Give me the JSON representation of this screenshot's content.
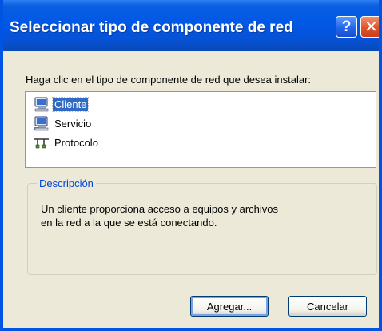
{
  "window": {
    "title": "Seleccionar tipo de componente de red",
    "help_label": "?",
    "close_label": "✕"
  },
  "prompt": "Haga clic en el tipo de componente de red que desea instalar:",
  "components": [
    {
      "label": "Cliente",
      "icon": "client-computer-icon",
      "selected": true
    },
    {
      "label": "Servicio",
      "icon": "service-computer-icon",
      "selected": false
    },
    {
      "label": "Protocolo",
      "icon": "protocol-network-icon",
      "selected": false
    }
  ],
  "description": {
    "title": "Descripción",
    "text_line1": "Un cliente proporciona acceso a equipos y archivos",
    "text_line2": "en la red a la que se está conectando."
  },
  "buttons": {
    "add_prefix": "A",
    "add_mnemonic": "g",
    "add_suffix": "regar...",
    "cancel": "Cancelar"
  },
  "colors": {
    "titlebar": "#0058e6",
    "selection": "#316ac5",
    "group_title": "#0046d5",
    "dialog_bg": "#ece9d8"
  }
}
